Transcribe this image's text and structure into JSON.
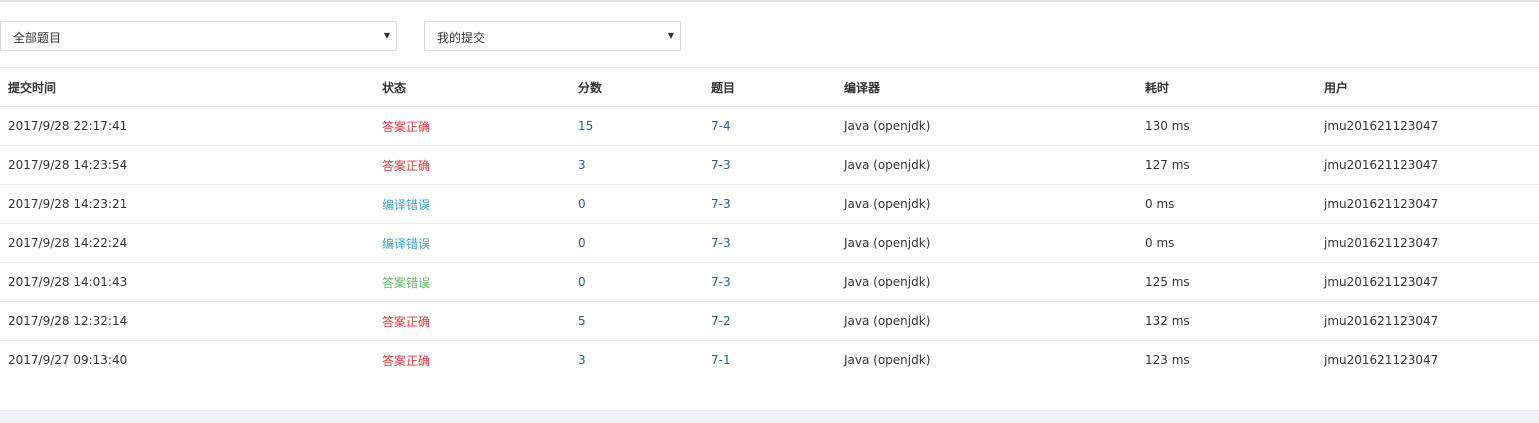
{
  "filters": {
    "problem_select": {
      "value": "全部题目"
    },
    "submission_select": {
      "value": "我的提交"
    }
  },
  "colors": {
    "accepted": "#e4393c",
    "compile_error": "#3aa0d8",
    "wrong_answer": "#5cb85c",
    "link": "#2a5c91"
  },
  "table": {
    "headers": {
      "time": "提交时间",
      "status": "状态",
      "score": "分数",
      "problem": "题目",
      "compiler": "编译器",
      "duration": "耗时",
      "user": "用户"
    },
    "rows": [
      {
        "time": "2017/9/28 22:17:41",
        "status": "答案正确",
        "status_type": "accepted",
        "score": "15",
        "problem": "7-4",
        "compiler": "Java (openjdk)",
        "duration": "130 ms",
        "user": "jmu201621123047"
      },
      {
        "time": "2017/9/28 14:23:54",
        "status": "答案正确",
        "status_type": "accepted",
        "score": "3",
        "problem": "7-3",
        "compiler": "Java (openjdk)",
        "duration": "127 ms",
        "user": "jmu201621123047"
      },
      {
        "time": "2017/9/28 14:23:21",
        "status": "编译错误",
        "status_type": "compile_error",
        "score": "0",
        "problem": "7-3",
        "compiler": "Java (openjdk)",
        "duration": "0 ms",
        "user": "jmu201621123047"
      },
      {
        "time": "2017/9/28 14:22:24",
        "status": "编译错误",
        "status_type": "compile_error",
        "score": "0",
        "problem": "7-3",
        "compiler": "Java (openjdk)",
        "duration": "0 ms",
        "user": "jmu201621123047"
      },
      {
        "time": "2017/9/28 14:01:43",
        "status": "答案错误",
        "status_type": "wrong_answer",
        "score": "0",
        "problem": "7-3",
        "compiler": "Java (openjdk)",
        "duration": "125 ms",
        "user": "jmu201621123047"
      },
      {
        "time": "2017/9/28 12:32:14",
        "status": "答案正确",
        "status_type": "accepted",
        "score": "5",
        "problem": "7-2",
        "compiler": "Java (openjdk)",
        "duration": "132 ms",
        "user": "jmu201621123047"
      },
      {
        "time": "2017/9/27 09:13:40",
        "status": "答案正确",
        "status_type": "accepted",
        "score": "3",
        "problem": "7-1",
        "compiler": "Java (openjdk)",
        "duration": "123 ms",
        "user": "jmu201621123047"
      }
    ]
  }
}
